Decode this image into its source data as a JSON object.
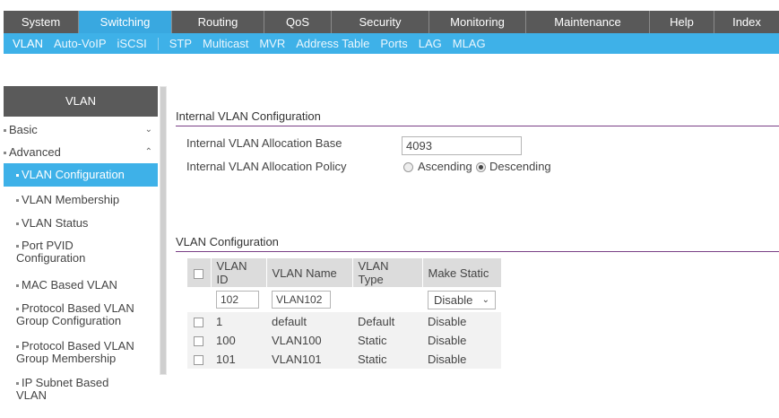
{
  "topnav": [
    {
      "label": "System",
      "active": false
    },
    {
      "label": "Switching",
      "active": true
    },
    {
      "label": "Routing",
      "active": false
    },
    {
      "label": "QoS",
      "active": false
    },
    {
      "label": "Security",
      "active": false
    },
    {
      "label": "Monitoring",
      "active": false
    },
    {
      "label": "Maintenance",
      "active": false
    },
    {
      "label": "Help",
      "active": false
    },
    {
      "label": "Index",
      "active": false
    }
  ],
  "subnav": [
    "VLAN",
    "Auto-VoIP",
    "iSCSI",
    "STP",
    "Multicast",
    "MVR",
    "Address Table",
    "Ports",
    "LAG",
    "MLAG"
  ],
  "sidebar": {
    "header": "VLAN",
    "items": [
      {
        "label": "Basic",
        "chevron": "⌄"
      },
      {
        "label": "Advanced",
        "chevron": "⌃"
      },
      {
        "label": "VLAN Configuration"
      },
      {
        "label": "VLAN Membership"
      },
      {
        "label": "VLAN Status"
      },
      {
        "label": "Port PVID Configuration"
      },
      {
        "label": "MAC Based VLAN"
      },
      {
        "label": "Protocol Based VLAN Group Configuration"
      },
      {
        "label": "Protocol Based VLAN Group Membership"
      },
      {
        "label": "IP Subnet Based VLAN"
      }
    ]
  },
  "internal": {
    "title": "Internal VLAN Configuration",
    "base_label": "Internal VLAN Allocation Base",
    "base_value": "4093",
    "policy_label": "Internal VLAN Allocation Policy",
    "ascending": "Ascending",
    "descending": "Descending",
    "policy_selected": "Descending"
  },
  "vlan_config": {
    "title": "VLAN Configuration",
    "headers": [
      "VLAN ID",
      "VLAN Name",
      "VLAN Type",
      "Make Static"
    ],
    "new_row": {
      "vlan_id": "102",
      "vlan_name": "VLAN102",
      "make_static": "Disable"
    },
    "rows": [
      {
        "vlan_id": "1",
        "vlan_name": "default",
        "vlan_type": "Default",
        "make_static": "Disable"
      },
      {
        "vlan_id": "100",
        "vlan_name": "VLAN100",
        "vlan_type": "Static",
        "make_static": "Disable"
      },
      {
        "vlan_id": "101",
        "vlan_name": "VLAN101",
        "vlan_type": "Static",
        "make_static": "Disable"
      }
    ]
  },
  "colors": {
    "accent": "#3eb1e8",
    "nav_bg": "#595959",
    "section_line": "#7a3f86"
  }
}
